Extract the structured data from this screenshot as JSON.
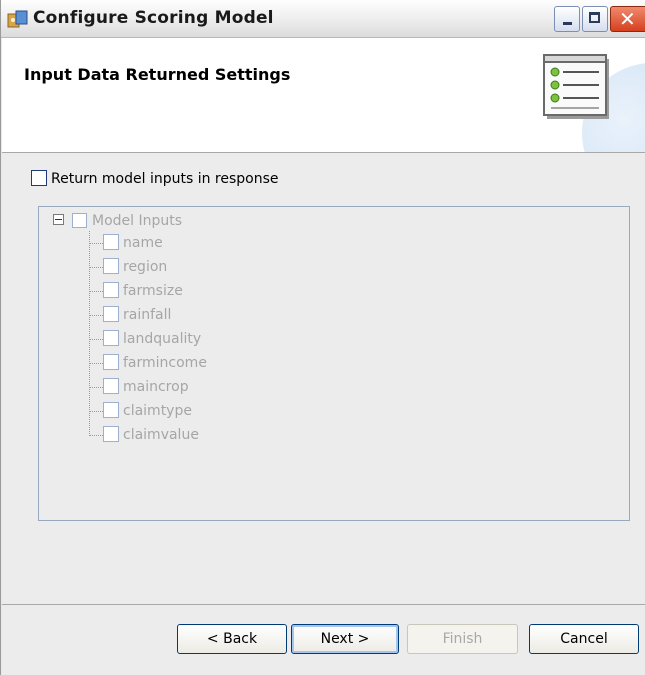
{
  "window": {
    "title": "Configure Scoring Model"
  },
  "banner": {
    "title": "Input Data Returned Settings"
  },
  "options": {
    "return_inputs_label": "Return model inputs in response",
    "return_inputs_checked": false
  },
  "tree": {
    "root_label": "Model Inputs",
    "items": [
      "name",
      "region",
      "farmsize",
      "rainfall",
      "landquality",
      "farmincome",
      "maincrop",
      "claimtype",
      "claimvalue"
    ]
  },
  "buttons": {
    "back": "< Back",
    "next": "Next >",
    "finish": "Finish",
    "cancel": "Cancel"
  },
  "colors": {
    "disabled_text": "#a6a6a6",
    "close_button": "#d6401e",
    "button_border": "#003c74"
  }
}
